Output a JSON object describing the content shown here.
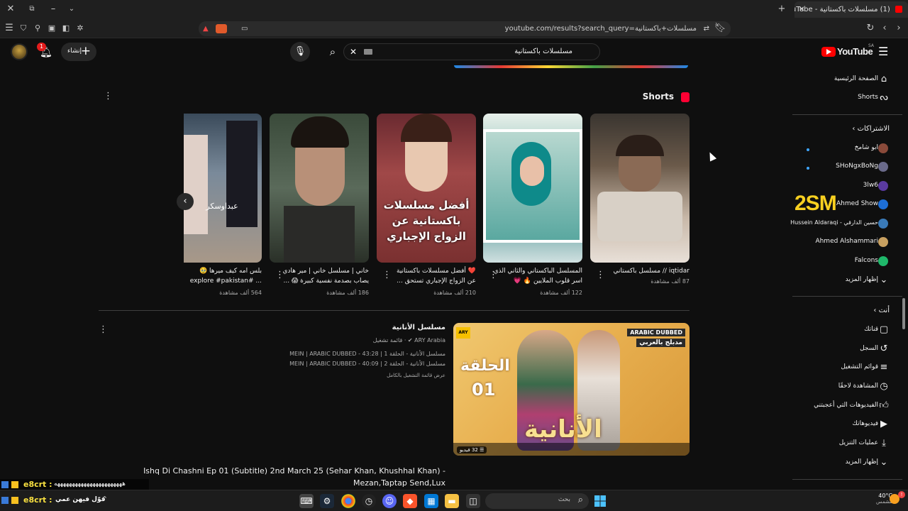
{
  "browser": {
    "tab_title": "(1) مسلسلات باكستانية - YouTube",
    "url": "youtube.com/results?search_query=مسلسلات+باكستانية"
  },
  "header": {
    "logo_text": "YouTube",
    "logo_sup": "SA",
    "search_value": "مسلسلات باكستانية",
    "create_label": "إنشاء",
    "notif_count": "1"
  },
  "sidebar": {
    "main": [
      {
        "label": "الصفحة الرئيسية",
        "icon": "home-icon"
      },
      {
        "label": "Shorts",
        "icon": "shorts-icon"
      }
    ],
    "subs_heading": "الاشتراكات",
    "subs": [
      {
        "label": "ابو شامخ",
        "color": "#8a4a3a",
        "dot": true
      },
      {
        "label": "SHoNgxBoNg",
        "color": "#6a6a8a",
        "dot": true
      },
      {
        "label": "3lw6",
        "color": "#5a3aa0",
        "dot": false
      },
      {
        "label": "Ahmed Show",
        "color": "#1d6fd8",
        "dot": false
      },
      {
        "label": "حسين الدارقي - Hussein Aldaraqi",
        "color": "#3a7ab8",
        "dot": false
      },
      {
        "label": "Ahmed Alshammari",
        "color": "#c8a060",
        "dot": false
      },
      {
        "label": "Falcons",
        "color": "#1fb86a",
        "dot": false
      }
    ],
    "subs_more": "إظهار المزيد",
    "you_heading": "أنت",
    "you_items": [
      {
        "label": "قناتك",
        "icon": "channel-icon"
      },
      {
        "label": "السجل",
        "icon": "history-icon"
      },
      {
        "label": "قوائم التشغيل",
        "icon": "playlists-icon"
      },
      {
        "label": "المشاهدة لاحقًا",
        "icon": "watch-later-icon"
      },
      {
        "label": "الفيديوهات التي أعجبتني",
        "icon": "liked-icon"
      },
      {
        "label": "فيديوهاتك",
        "icon": "your-videos-icon"
      },
      {
        "label": "عمليات التنزيل",
        "icon": "download-icon"
      },
      {
        "label": "إظهار المزيد",
        "icon": "chevron-down-icon"
      }
    ]
  },
  "overlay": {
    "badge_text": "2SM",
    "badge_sub": "حسين الدارقي"
  },
  "shorts": {
    "heading": "Shorts",
    "items": [
      {
        "title1": "iqtidar // مسلسل باكستاني",
        "title2": "",
        "views": "87 ألف مشاهدة",
        "overlay": ""
      },
      {
        "title1": "المسلسل الباكستاني والثاني الذي",
        "title2": "اسر قلوب الملايين 🔥 💗",
        "views": "122 ألف مشاهدة",
        "overlay": ""
      },
      {
        "title1": "❤️ أفضل مسلسلات باكستانية",
        "title2": "عن الزواج الإجباري تستحق ...",
        "views": "210 ألف مشاهدة",
        "overlay": "أفضل مسلسلات باكستانية عن الزواج الإجباري"
      },
      {
        "title1": "خاني | مسلسل خاني | مير هادي",
        "title2": "يصاب بصدمة نفسية كبيرة 😱 ...",
        "views": "186 ألف مشاهدة",
        "overlay": ""
      },
      {
        "title1": "بلس امه كيف ميرها 🥹",
        "title2": "explore #pakistan# ...",
        "views": "564 ألف مشاهدة",
        "overlay": "عبداوسكر"
      }
    ]
  },
  "playlist": {
    "title": "مسلسل الأنانية",
    "channel": "ARY Arabia",
    "channel_suffix": "قائمة تشغيل",
    "lines": [
      "مسلسل الأنانية - الحلقة 1 | MEIN | ARABIC DUBBED - 43:28",
      "مسلسل الأنانية - الحلقة 2 | MEIN | ARABIC DUBBED - 40:09"
    ],
    "view_full": "عرض قائمة التشغيل بالكامل",
    "thumb_badge": "ARABIC DUBBED",
    "thumb_badge_sub": "مدبلج بالعربي",
    "thumb_ep": "الحلقة",
    "thumb_ep_num": "01",
    "thumb_title": "الأنانية",
    "thumb_logo": "ARY",
    "video_count": "32 فيديو"
  },
  "next_video": {
    "title": "Ishq Di Chashni Ep 01 (Subtitle) 2nd March 25 (Sehar Khan, Khushhal Khan) - Mezan,Taptap Send,Lux"
  },
  "chat_overlay": {
    "line1_name": "e8crt :",
    "line1_text": "هههههههههههههههههههههههه",
    "line2_name": "e8crt :",
    "line2_text": "قوّل فيهن عمي"
  },
  "taskbar": {
    "search_placeholder": "بحث",
    "weather_temp": "40°C",
    "weather_desc": "مشمس"
  }
}
